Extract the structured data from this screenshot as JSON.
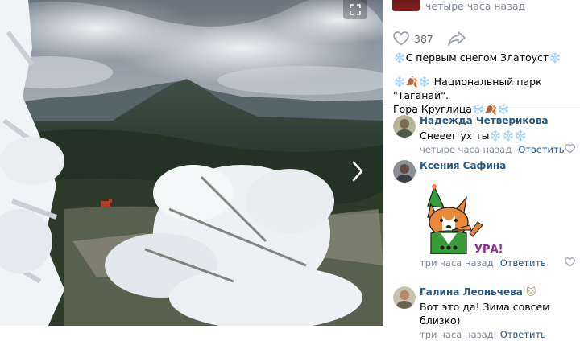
{
  "header": {
    "time": "четыре часа назад"
  },
  "actions": {
    "likes": "387"
  },
  "post": {
    "line1": "❄️С первым снегом Златоуст❄️",
    "line2a": "❄️🍂❄️ Национальный парк \"Таганай\".",
    "line2b": "Гора Круглица❄️🍂❄️"
  },
  "comments": [
    {
      "author": "Надежда Четверикова",
      "text": "Снееег ух ты❄️❄️❄️",
      "time": "четыре часа назад",
      "reply": "Ответить"
    },
    {
      "author": "Ксения Сафина",
      "sticker_text": "УРА!",
      "time": "три часа назад",
      "reply": "Ответить"
    },
    {
      "author": "Галина Леоньчева",
      "text": "Вот это да! Зима совсем близко)",
      "time": "три часа назад",
      "reply": "Ответить"
    }
  ],
  "colors": {
    "link": "#2a5885",
    "meta": "#818c99",
    "sticker_green": "#3a9b3a",
    "sticker_orange": "#e88a3a"
  }
}
